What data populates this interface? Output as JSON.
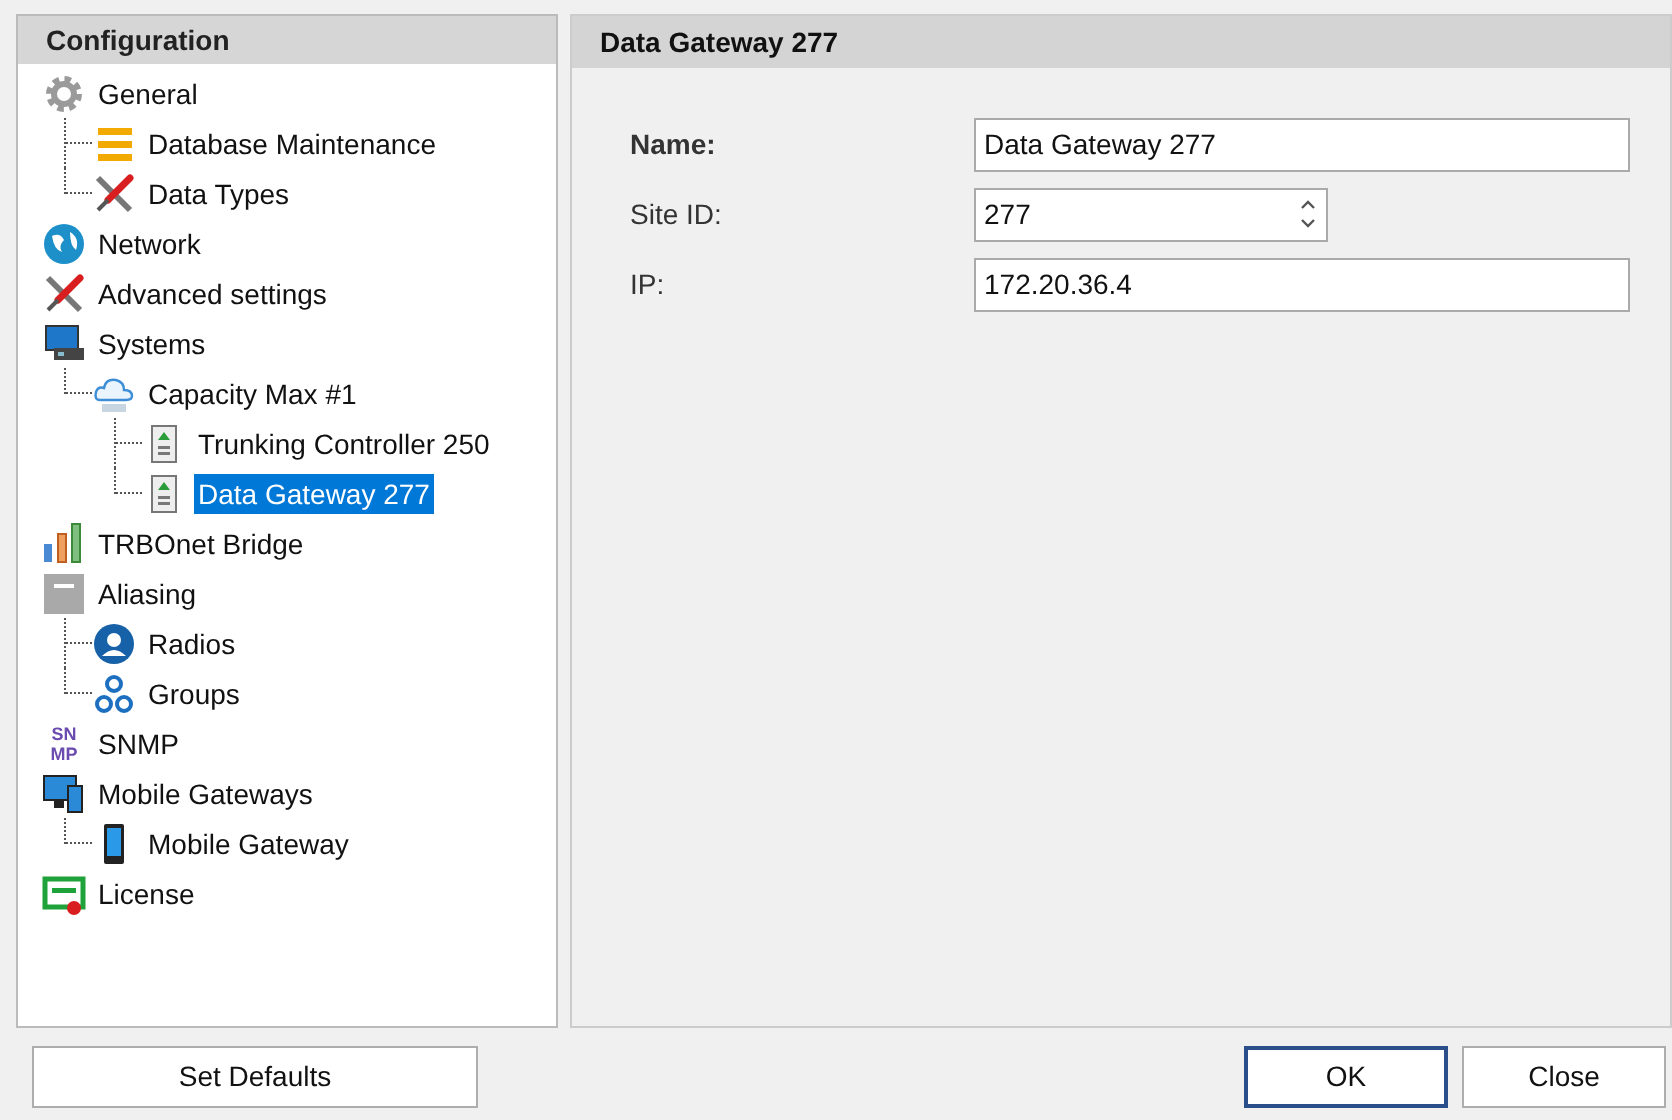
{
  "sidebar": {
    "title": "Configuration",
    "items": [
      {
        "label": "General",
        "kind": "gear",
        "selected": false,
        "children": [
          {
            "label": "Database Maintenance",
            "kind": "database",
            "selected": false
          },
          {
            "label": "Data Types",
            "kind": "tools",
            "selected": false
          }
        ]
      },
      {
        "label": "Network",
        "kind": "globe",
        "selected": false
      },
      {
        "label": "Advanced settings",
        "kind": "tools",
        "selected": false
      },
      {
        "label": "Systems",
        "kind": "systems",
        "selected": false,
        "children": [
          {
            "label": "Capacity Max #1",
            "kind": "cloud",
            "selected": false,
            "children": [
              {
                "label": "Trunking Controller 250",
                "kind": "server",
                "selected": false
              },
              {
                "label": "Data Gateway 277",
                "kind": "server",
                "selected": true
              }
            ]
          }
        ]
      },
      {
        "label": "TRBOnet Bridge",
        "kind": "bars",
        "selected": false
      },
      {
        "label": "Aliasing",
        "kind": "box",
        "selected": false,
        "children": [
          {
            "label": "Radios",
            "kind": "user",
            "selected": false
          },
          {
            "label": "Groups",
            "kind": "group",
            "selected": false
          }
        ]
      },
      {
        "label": "SNMP",
        "kind": "snmp",
        "selected": false,
        "badge": [
          "SN",
          "MP"
        ]
      },
      {
        "label": "Mobile Gateways",
        "kind": "devices",
        "selected": false,
        "children": [
          {
            "label": "Mobile Gateway",
            "kind": "phone",
            "selected": false
          }
        ]
      },
      {
        "label": "License",
        "kind": "license",
        "selected": false
      }
    ]
  },
  "panel": {
    "title": "Data Gateway 277",
    "fields": [
      {
        "label": "Name:",
        "bold": true,
        "kind": "text",
        "value": "Data Gateway 277"
      },
      {
        "label": "Site ID:",
        "bold": false,
        "kind": "spin",
        "value": "277"
      },
      {
        "label": "IP:",
        "bold": false,
        "kind": "text",
        "value": "172.20.36.4"
      }
    ]
  },
  "buttons": {
    "left": "Set Defaults",
    "ok": "OK",
    "close": "Close"
  }
}
